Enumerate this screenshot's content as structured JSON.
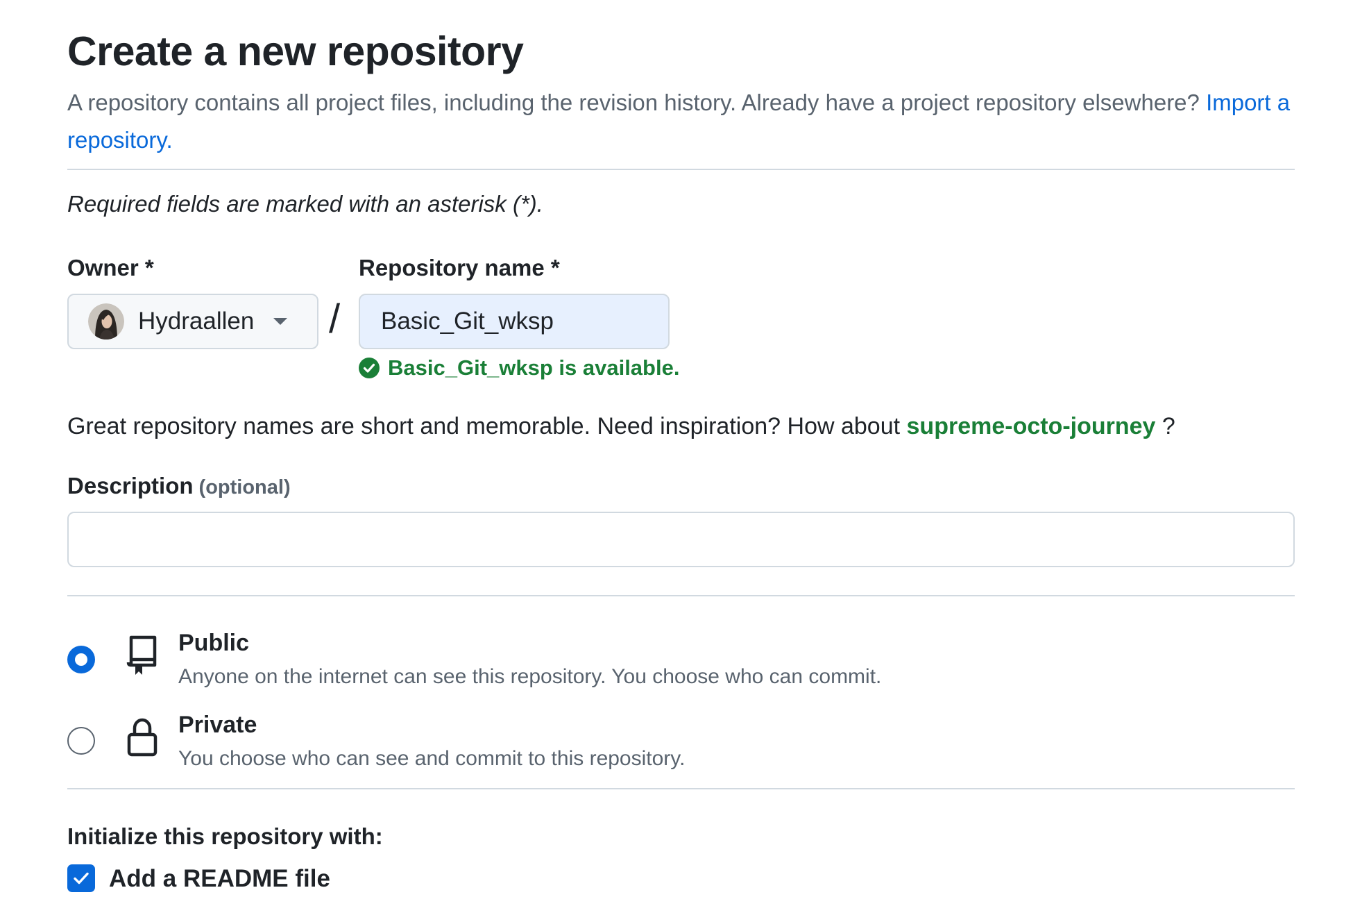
{
  "header": {
    "title": "Create a new repository",
    "intro_text": "A repository contains all project files, including the revision history. Already have a project repository elsewhere?",
    "import_link": "Import a repository."
  },
  "form": {
    "required_note": "Required fields are marked with an asterisk (*).",
    "owner": {
      "label": "Owner *",
      "value": "Hydraallen"
    },
    "separator": "/",
    "repo_name": {
      "label": "Repository name *",
      "value": "Basic_Git_wksp",
      "availability": "Basic_Git_wksp is available."
    },
    "inspiration": {
      "text": "Great repository names are short and memorable. Need inspiration? How about",
      "suggestion": "supreme-octo-journey",
      "suffix": "?"
    },
    "description": {
      "label": "Description",
      "optional": "(optional)",
      "value": ""
    },
    "visibility": {
      "selected": "public",
      "public": {
        "title": "Public",
        "desc": "Anyone on the internet can see this repository. You choose who can commit.",
        "icon": "repo-icon"
      },
      "private": {
        "title": "Private",
        "desc": "You choose who can see and commit to this repository.",
        "icon": "lock-icon"
      }
    },
    "initialize": {
      "label": "Initialize this repository with:",
      "readme": {
        "label": "Add a README file",
        "checked": true
      }
    }
  },
  "colors": {
    "accent": "#0969da",
    "success": "#1a7f37",
    "muted": "#59636e",
    "border": "#d1d9e0",
    "input_autofill": "#e7f0fe"
  }
}
